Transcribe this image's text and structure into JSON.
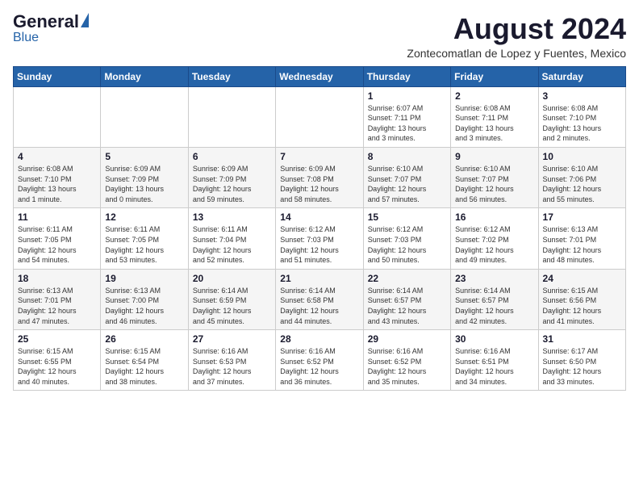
{
  "header": {
    "logo_general": "General",
    "logo_blue": "Blue",
    "month_year": "August 2024",
    "location": "Zontecomatlan de Lopez y Fuentes, Mexico"
  },
  "weekdays": [
    "Sunday",
    "Monday",
    "Tuesday",
    "Wednesday",
    "Thursday",
    "Friday",
    "Saturday"
  ],
  "weeks": [
    [
      {
        "day": "",
        "info": ""
      },
      {
        "day": "",
        "info": ""
      },
      {
        "day": "",
        "info": ""
      },
      {
        "day": "",
        "info": ""
      },
      {
        "day": "1",
        "info": "Sunrise: 6:07 AM\nSunset: 7:11 PM\nDaylight: 13 hours\nand 3 minutes."
      },
      {
        "day": "2",
        "info": "Sunrise: 6:08 AM\nSunset: 7:11 PM\nDaylight: 13 hours\nand 3 minutes."
      },
      {
        "day": "3",
        "info": "Sunrise: 6:08 AM\nSunset: 7:10 PM\nDaylight: 13 hours\nand 2 minutes."
      }
    ],
    [
      {
        "day": "4",
        "info": "Sunrise: 6:08 AM\nSunset: 7:10 PM\nDaylight: 13 hours\nand 1 minute."
      },
      {
        "day": "5",
        "info": "Sunrise: 6:09 AM\nSunset: 7:09 PM\nDaylight: 13 hours\nand 0 minutes."
      },
      {
        "day": "6",
        "info": "Sunrise: 6:09 AM\nSunset: 7:09 PM\nDaylight: 12 hours\nand 59 minutes."
      },
      {
        "day": "7",
        "info": "Sunrise: 6:09 AM\nSunset: 7:08 PM\nDaylight: 12 hours\nand 58 minutes."
      },
      {
        "day": "8",
        "info": "Sunrise: 6:10 AM\nSunset: 7:07 PM\nDaylight: 12 hours\nand 57 minutes."
      },
      {
        "day": "9",
        "info": "Sunrise: 6:10 AM\nSunset: 7:07 PM\nDaylight: 12 hours\nand 56 minutes."
      },
      {
        "day": "10",
        "info": "Sunrise: 6:10 AM\nSunset: 7:06 PM\nDaylight: 12 hours\nand 55 minutes."
      }
    ],
    [
      {
        "day": "11",
        "info": "Sunrise: 6:11 AM\nSunset: 7:05 PM\nDaylight: 12 hours\nand 54 minutes."
      },
      {
        "day": "12",
        "info": "Sunrise: 6:11 AM\nSunset: 7:05 PM\nDaylight: 12 hours\nand 53 minutes."
      },
      {
        "day": "13",
        "info": "Sunrise: 6:11 AM\nSunset: 7:04 PM\nDaylight: 12 hours\nand 52 minutes."
      },
      {
        "day": "14",
        "info": "Sunrise: 6:12 AM\nSunset: 7:03 PM\nDaylight: 12 hours\nand 51 minutes."
      },
      {
        "day": "15",
        "info": "Sunrise: 6:12 AM\nSunset: 7:03 PM\nDaylight: 12 hours\nand 50 minutes."
      },
      {
        "day": "16",
        "info": "Sunrise: 6:12 AM\nSunset: 7:02 PM\nDaylight: 12 hours\nand 49 minutes."
      },
      {
        "day": "17",
        "info": "Sunrise: 6:13 AM\nSunset: 7:01 PM\nDaylight: 12 hours\nand 48 minutes."
      }
    ],
    [
      {
        "day": "18",
        "info": "Sunrise: 6:13 AM\nSunset: 7:01 PM\nDaylight: 12 hours\nand 47 minutes."
      },
      {
        "day": "19",
        "info": "Sunrise: 6:13 AM\nSunset: 7:00 PM\nDaylight: 12 hours\nand 46 minutes."
      },
      {
        "day": "20",
        "info": "Sunrise: 6:14 AM\nSunset: 6:59 PM\nDaylight: 12 hours\nand 45 minutes."
      },
      {
        "day": "21",
        "info": "Sunrise: 6:14 AM\nSunset: 6:58 PM\nDaylight: 12 hours\nand 44 minutes."
      },
      {
        "day": "22",
        "info": "Sunrise: 6:14 AM\nSunset: 6:57 PM\nDaylight: 12 hours\nand 43 minutes."
      },
      {
        "day": "23",
        "info": "Sunrise: 6:14 AM\nSunset: 6:57 PM\nDaylight: 12 hours\nand 42 minutes."
      },
      {
        "day": "24",
        "info": "Sunrise: 6:15 AM\nSunset: 6:56 PM\nDaylight: 12 hours\nand 41 minutes."
      }
    ],
    [
      {
        "day": "25",
        "info": "Sunrise: 6:15 AM\nSunset: 6:55 PM\nDaylight: 12 hours\nand 40 minutes."
      },
      {
        "day": "26",
        "info": "Sunrise: 6:15 AM\nSunset: 6:54 PM\nDaylight: 12 hours\nand 38 minutes."
      },
      {
        "day": "27",
        "info": "Sunrise: 6:16 AM\nSunset: 6:53 PM\nDaylight: 12 hours\nand 37 minutes."
      },
      {
        "day": "28",
        "info": "Sunrise: 6:16 AM\nSunset: 6:52 PM\nDaylight: 12 hours\nand 36 minutes."
      },
      {
        "day": "29",
        "info": "Sunrise: 6:16 AM\nSunset: 6:52 PM\nDaylight: 12 hours\nand 35 minutes."
      },
      {
        "day": "30",
        "info": "Sunrise: 6:16 AM\nSunset: 6:51 PM\nDaylight: 12 hours\nand 34 minutes."
      },
      {
        "day": "31",
        "info": "Sunrise: 6:17 AM\nSunset: 6:50 PM\nDaylight: 12 hours\nand 33 minutes."
      }
    ]
  ]
}
